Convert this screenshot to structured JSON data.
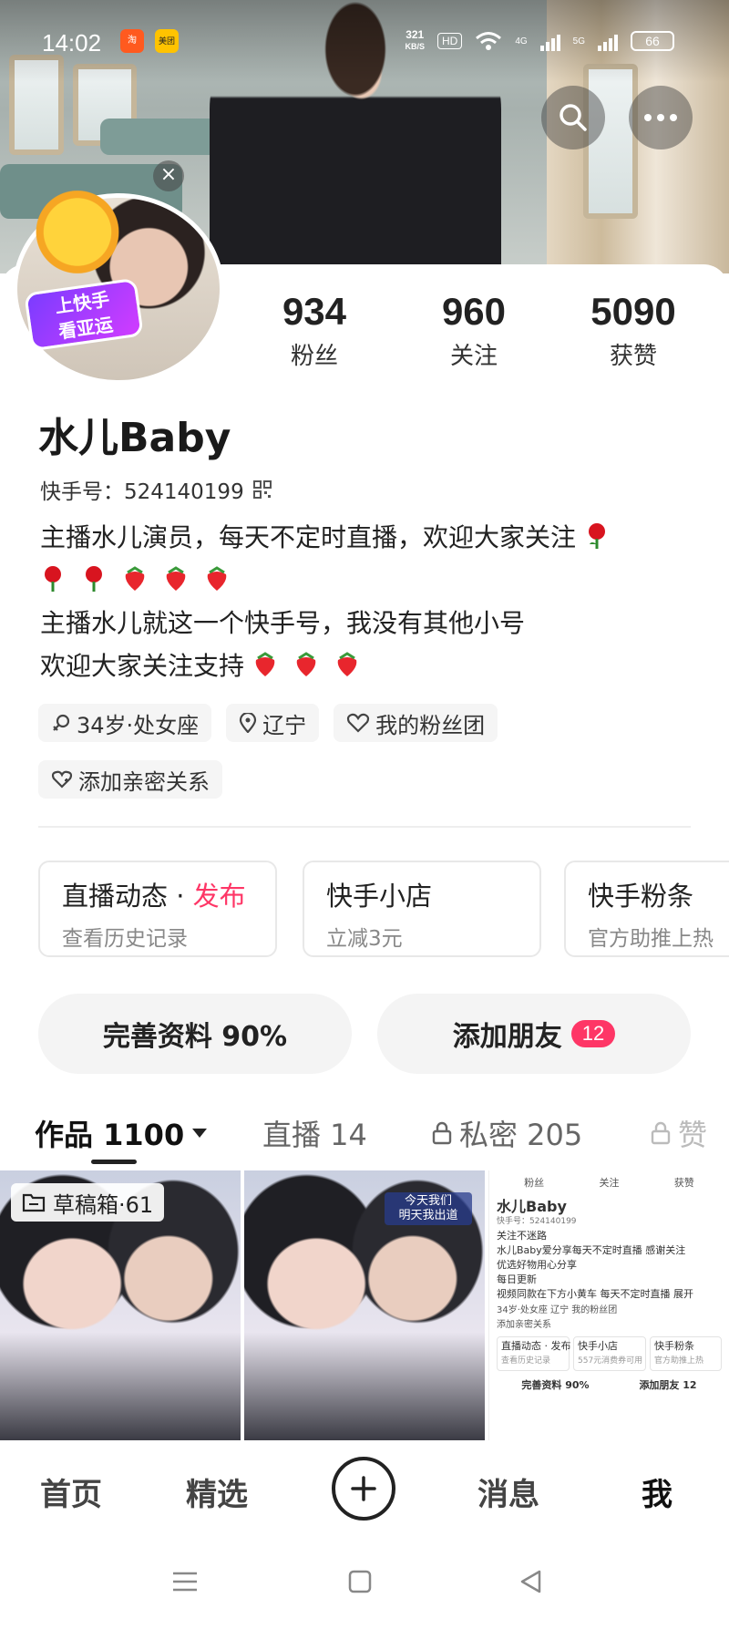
{
  "status_bar": {
    "time": "14:02",
    "network_speed": "321",
    "network_unit": "KB/S",
    "hd_label": "HD",
    "net1": "4G",
    "net2": "5G",
    "battery": "66",
    "app_badges": [
      "淘",
      "美团"
    ]
  },
  "profile": {
    "followers_count": "934",
    "followers_label": "粉丝",
    "following_count": "960",
    "following_label": "关注",
    "likes_count": "5090",
    "likes_label": "获赞",
    "name": "水儿Baby",
    "kuaishou_id": "快手号：524140199",
    "bio_line1": "主播水儿演员，每天不定时直播，欢迎大家关注",
    "bio_line3": "主播水儿就这一个快手号，我没有其他小号",
    "bio_line4": "欢迎大家关注支持",
    "mascot_tag": "上快手\n看亚运",
    "avatar_close": "×"
  },
  "chips": {
    "age": "34岁·处女座",
    "location": "辽宁",
    "fan_club": "我的粉丝团",
    "add_relation": "添加亲密关系"
  },
  "cards": [
    {
      "title": "直播动态 · ",
      "title_accent": "发布",
      "subtitle": "查看历史记录"
    },
    {
      "title": "快手小店",
      "subtitle": "立减3元"
    },
    {
      "title": "快手粉条",
      "subtitle": "官方助推上热"
    }
  ],
  "actions": {
    "complete_profile": "完善资料 90%",
    "add_friends": "添加朋友",
    "add_friends_badge": "12"
  },
  "tabs": {
    "works": "作品 1100",
    "live": "直播 14",
    "private": "私密 205",
    "likes": "赞"
  },
  "grid": {
    "draft_label": "草稿箱·61",
    "pic_title": "今天我们\n明天我出道",
    "shot": {
      "stats": [
        "粉丝",
        "关注",
        "获赞"
      ],
      "name": "水儿Baby",
      "kid": "快手号：524140199",
      "lines": [
        "关注不迷路",
        "水儿Baby爱分享每天不定时直播 感谢关注",
        "优选好物用心分享",
        "每日更新",
        "视频同款在下方小黄车 每天不定时直播 展开"
      ],
      "chips": "34岁·处女座  辽宁  我的粉丝团",
      "relation": "添加亲密关系",
      "cards": [
        "直播动态 · 发布",
        "快手小店",
        "快手粉条"
      ],
      "card_subs": [
        "查看历史记录",
        "557元消费券可用",
        "官方助推上热"
      ],
      "btn1": "完善资料 90%",
      "btn2": "添加朋友 12"
    }
  },
  "bottom_nav": {
    "home": "首页",
    "featured": "精选",
    "messages": "消息",
    "me": "我"
  },
  "colors": {
    "accent": "#fe3666",
    "text": "#222222",
    "muted": "#888888"
  }
}
